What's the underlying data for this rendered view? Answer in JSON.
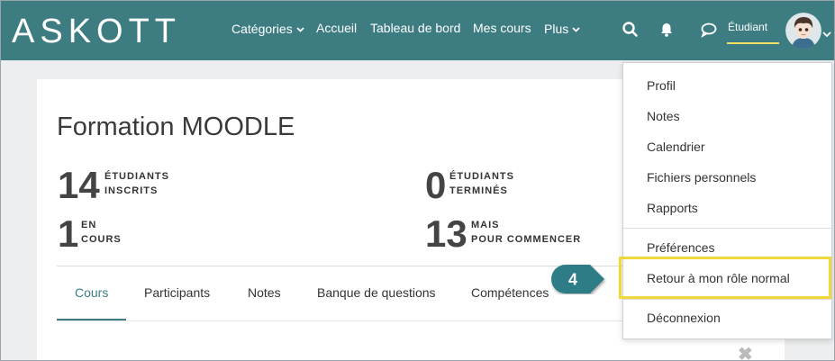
{
  "brand": {
    "name": "ASKOTT"
  },
  "nav": {
    "categories": "Catégories",
    "home": "Accueil",
    "dashboard": "Tableau de bord",
    "my_courses": "Mes cours",
    "more": "Plus"
  },
  "user": {
    "role": "Étudiant"
  },
  "course": {
    "title": "Formation MOODLE",
    "stats": [
      {
        "value": "14",
        "line1": "ÉTUDIANTS",
        "line2": "INSCRITS"
      },
      {
        "value": "0",
        "line1": "ÉTUDIANTS",
        "line2": "TERMINÉS"
      },
      {
        "value": "1",
        "line1": "EN",
        "line2": "COURS"
      },
      {
        "value": "13",
        "line1": "MAIS",
        "line2": "POUR COMMENCER"
      }
    ]
  },
  "tabs": [
    "Cours",
    "Participants",
    "Notes",
    "Banque de questions",
    "Compétences"
  ],
  "menu": {
    "items": [
      "Profil",
      "Notes",
      "Calendrier",
      "Fichiers personnels",
      "Rapports",
      "Préférences",
      "Retour à mon rôle normal",
      "Déconnexion"
    ]
  },
  "callout": {
    "number": "4"
  },
  "colors": {
    "navbar": "#3d7d82",
    "highlight": "#f0d83a",
    "callout": "#2f7d86"
  },
  "icons": [
    "search-icon",
    "bell-icon",
    "chat-icon",
    "close-icon"
  ]
}
